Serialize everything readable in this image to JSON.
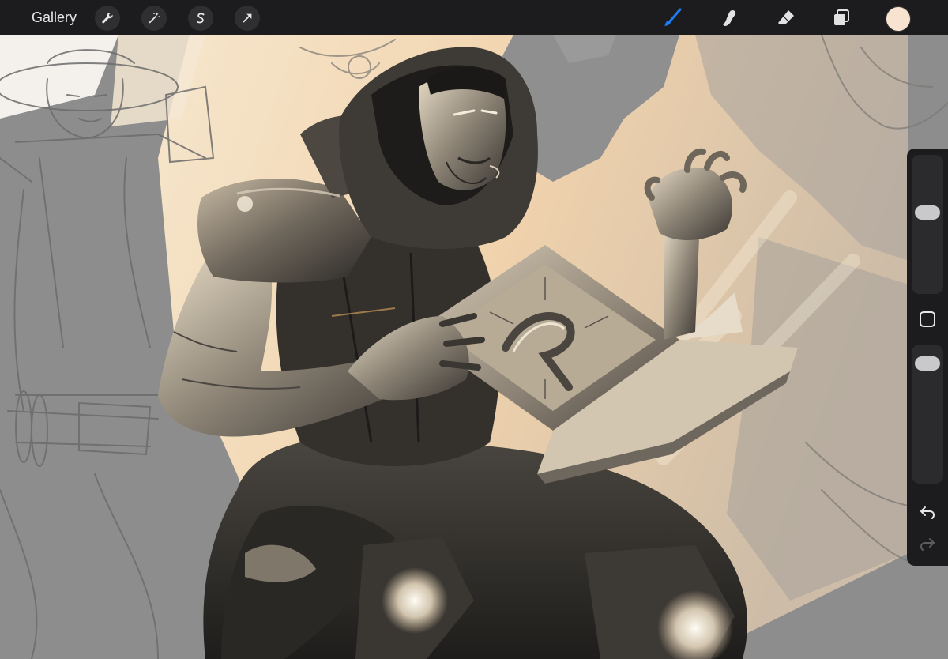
{
  "toolbar": {
    "gallery_label": "Gallery",
    "left_tools": [
      {
        "name": "actions",
        "icon": "wrench-icon"
      },
      {
        "name": "adjustments",
        "icon": "magic-wand-icon"
      },
      {
        "name": "selection",
        "icon": "selection-s-icon"
      },
      {
        "name": "transform",
        "icon": "arrow-cursor-icon"
      }
    ],
    "right_tools": [
      {
        "name": "brush",
        "icon": "brush-icon",
        "active": true
      },
      {
        "name": "smudge",
        "icon": "smudge-finger-icon",
        "active": false
      },
      {
        "name": "eraser",
        "icon": "eraser-icon",
        "active": false
      },
      {
        "name": "layers",
        "icon": "layers-icon",
        "active": false
      }
    ],
    "active_color": "#f7e3d0"
  },
  "side_panel": {
    "brush_size_level": 0.6,
    "opacity_level": 0.93,
    "modify_icon": "square-icon",
    "undo_icon": "undo-arrow-icon",
    "redo_icon": "redo-arrow-icon"
  },
  "colors": {
    "accent_blue": "#1c7cf2",
    "toolbar_bg": "#1c1c1e",
    "canvas_grey": "#8c8c8c",
    "warm_light": "#f3d9b6"
  }
}
